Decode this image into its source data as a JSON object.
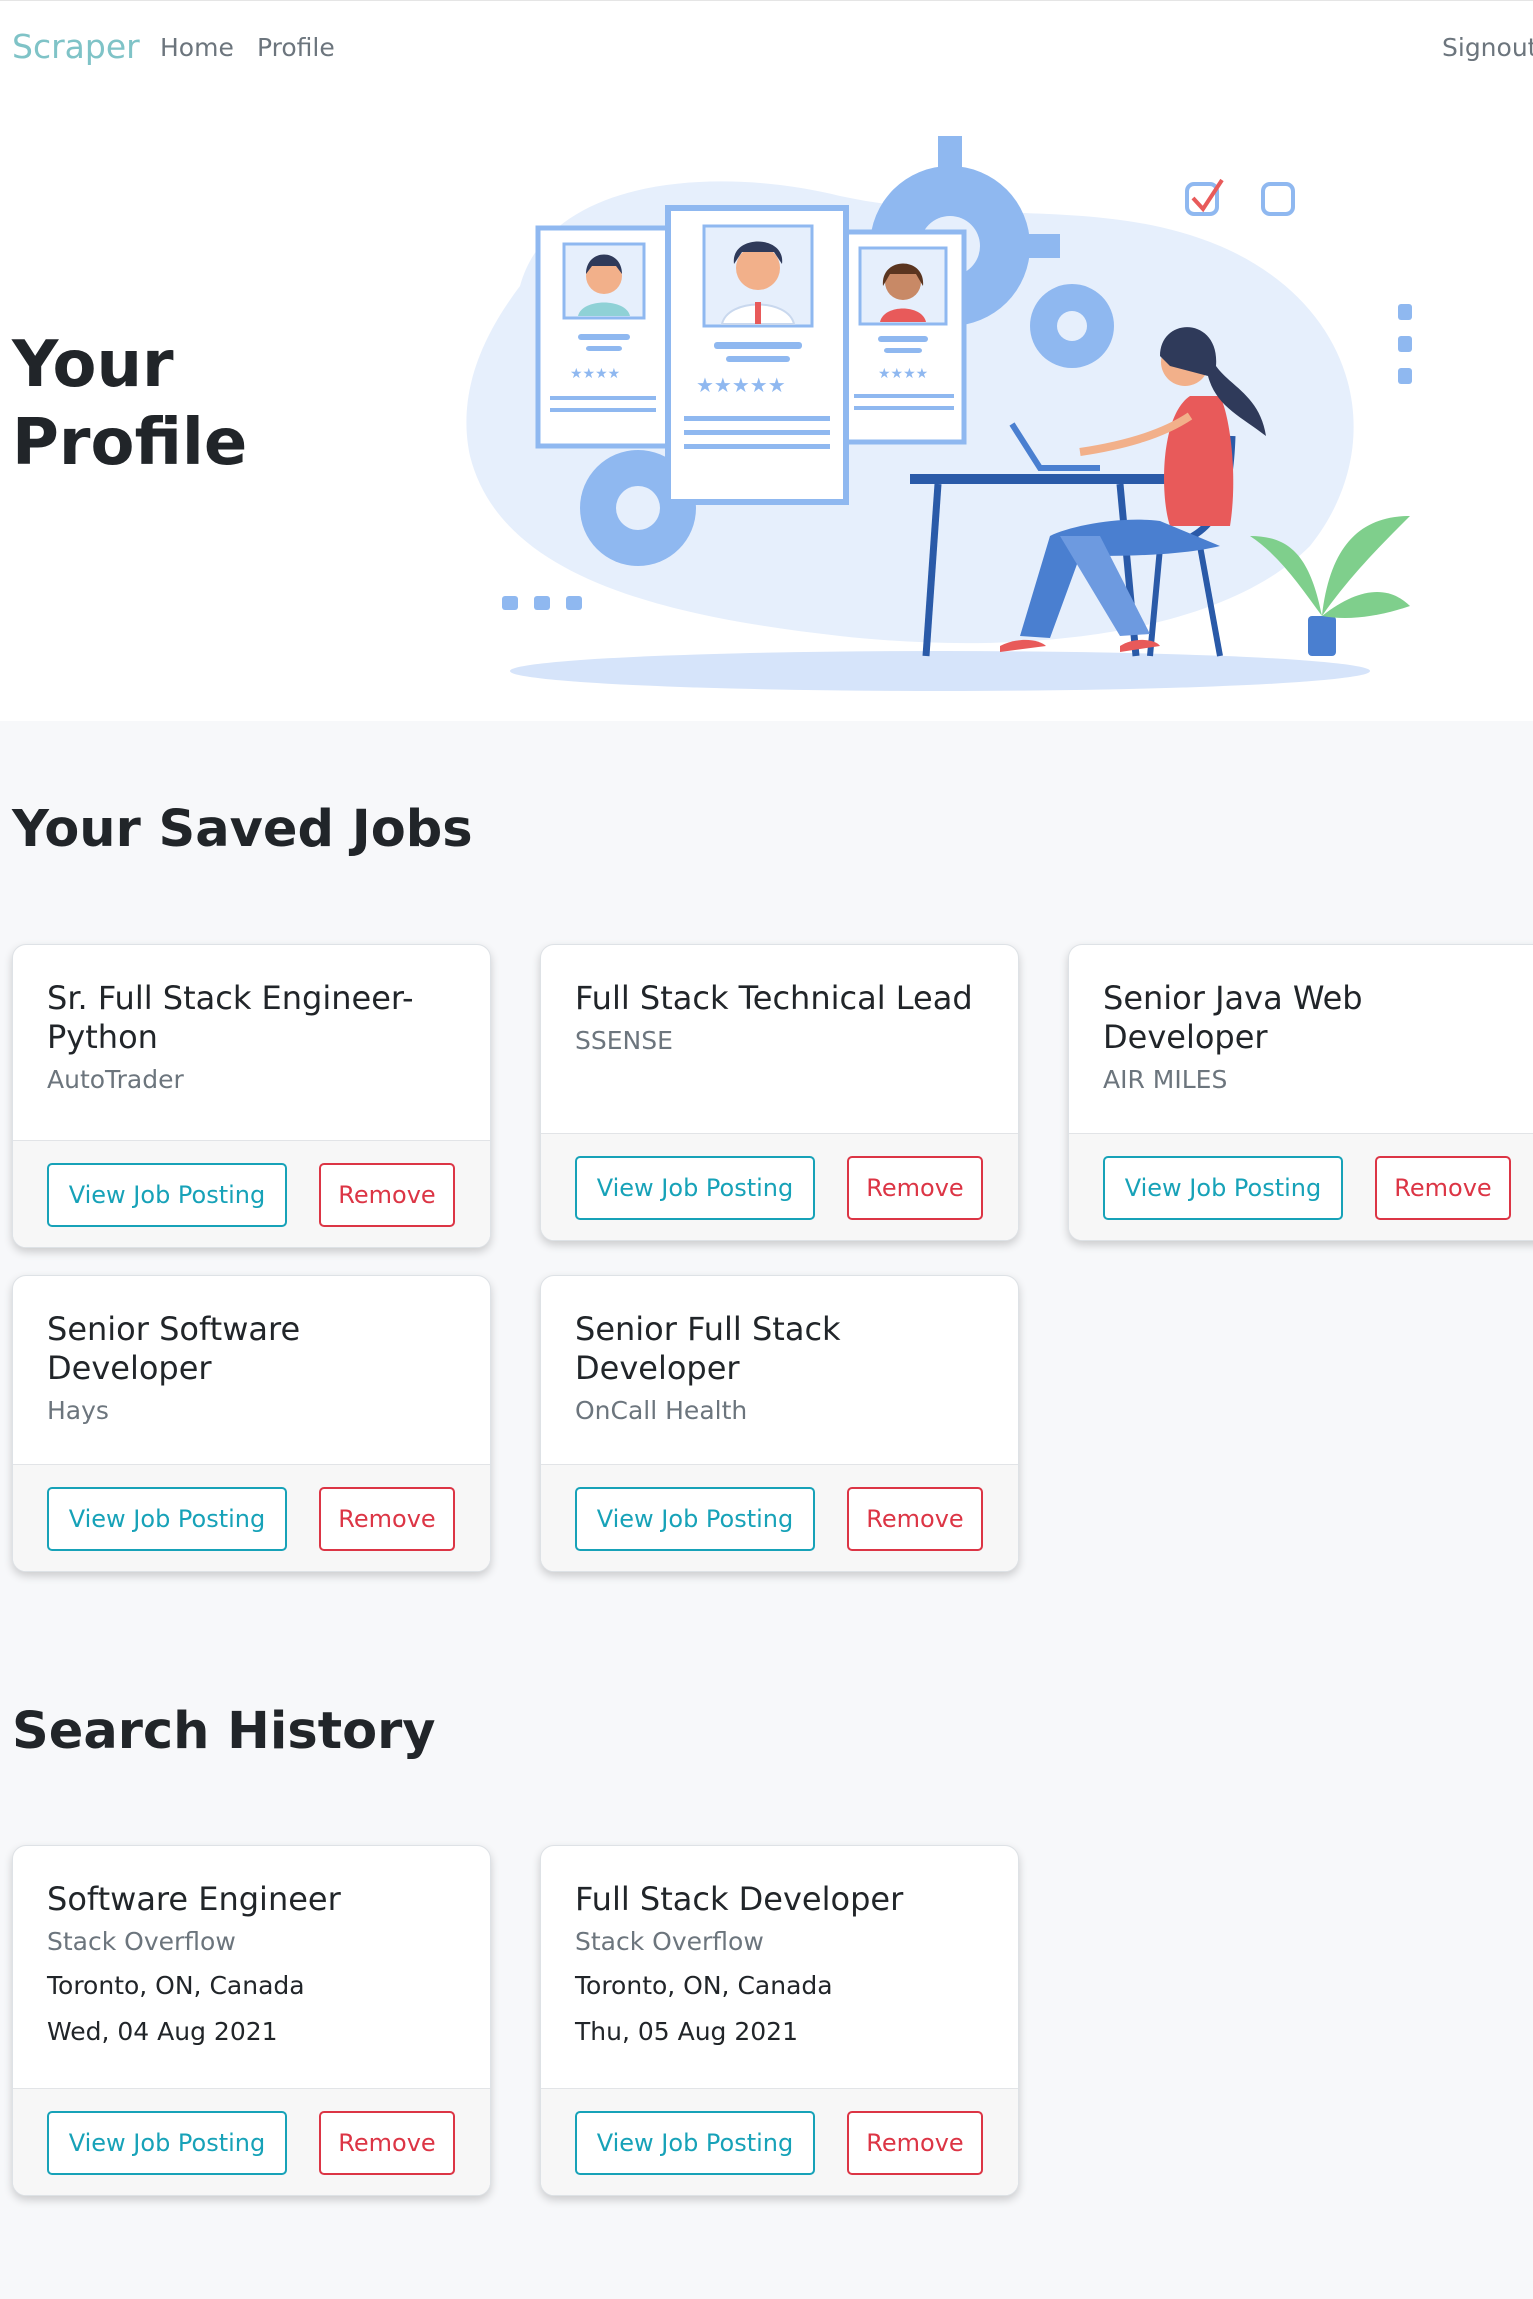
{
  "navbar": {
    "brand": "Scraper",
    "links": [
      "Home",
      "Profile"
    ],
    "signout": "Signout"
  },
  "hero": {
    "title": "Your Profile"
  },
  "saved_jobs": {
    "title": "Your Saved Jobs",
    "items": [
      {
        "title": "Sr. Full Stack Engineer-Python",
        "company": "AutoTrader",
        "view_label": "View Job Posting",
        "remove_label": "Remove"
      },
      {
        "title": "Full Stack Technical Lead",
        "company": "SSENSE",
        "view_label": "View Job Posting",
        "remove_label": "Remove"
      },
      {
        "title": "Senior Java Web Developer",
        "company": "AIR MILES",
        "view_label": "View Job Posting",
        "remove_label": "Remove"
      },
      {
        "title": "Senior Software Developer",
        "company": "Hays",
        "view_label": "View Job Posting",
        "remove_label": "Remove"
      },
      {
        "title": "Senior Full Stack Developer",
        "company": "OnCall Health",
        "view_label": "View Job Posting",
        "remove_label": "Remove"
      }
    ]
  },
  "search_history": {
    "title": "Search History",
    "items": [
      {
        "title": "Software Engineer",
        "source": "Stack Overflow",
        "location": "Toronto, ON, Canada",
        "date": "Wed, 04 Aug 2021",
        "view_label": "View Job Posting",
        "remove_label": "Remove"
      },
      {
        "title": "Full Stack Developer",
        "source": "Stack Overflow",
        "location": "Toronto, ON, Canada",
        "date": "Thu, 05 Aug 2021",
        "view_label": "View Job Posting",
        "remove_label": "Remove"
      }
    ]
  },
  "colors": {
    "brand": "#7fc3c7",
    "info": "#17a2b8",
    "danger": "#dc3545",
    "illustration_blue": "#8fb8f0"
  }
}
